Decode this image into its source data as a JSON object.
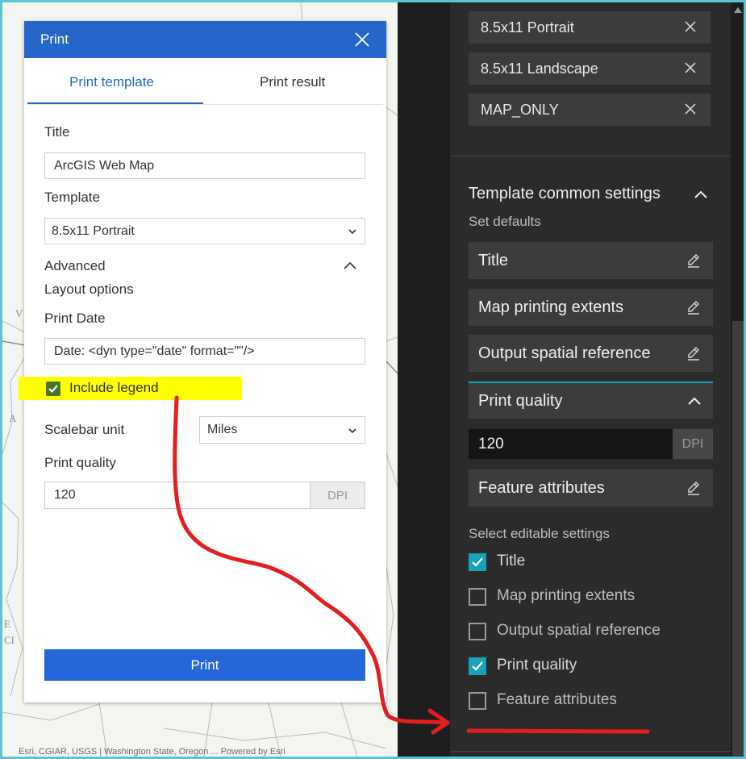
{
  "dialog": {
    "title": "Print",
    "tabs": [
      "Print template",
      "Print result"
    ],
    "title_label": "Title",
    "title_value": "ArcGIS Web Map",
    "template_label": "Template",
    "template_value": "8.5x11 Portrait",
    "advanced_label": "Advanced",
    "layout_options_label": "Layout options",
    "print_date_label": "Print Date",
    "print_date_value": "Date: <dyn type=\"date\" format=\"\"/>",
    "include_legend_label": "Include legend",
    "include_legend_checked": true,
    "scalebar_label": "Scalebar unit",
    "scalebar_value": "Miles",
    "print_quality_label": "Print quality",
    "print_quality_value": "120",
    "dpi_suffix": "DPI",
    "print_button": "Print"
  },
  "settings": {
    "template_chips": [
      "8.5x11 Portrait",
      "8.5x11 Landscape",
      "MAP_ONLY"
    ],
    "section_title": "Template common settings",
    "set_defaults": "Set defaults",
    "rows": {
      "title": "Title",
      "map_extents": "Map printing extents",
      "spatial_ref": "Output spatial reference",
      "print_quality": "Print quality",
      "feature_attributes": "Feature attributes"
    },
    "dpi_value": "120",
    "dpi_suffix": "DPI",
    "editable_heading": "Select editable settings",
    "editable": [
      {
        "label": "Title",
        "checked": true
      },
      {
        "label": "Map printing extents",
        "checked": false
      },
      {
        "label": "Output spatial reference",
        "checked": false
      },
      {
        "label": "Print quality",
        "checked": true
      },
      {
        "label": "Feature attributes",
        "checked": false
      }
    ]
  },
  "map": {
    "attribution": "Esri, CGIAR, USGS | Washington State, Oregon ... Powered by Esri"
  },
  "colors": {
    "accent_blue": "#2566c8",
    "teal_check": "#19a3b8",
    "highlight_yellow": "#ffff00",
    "annotation_red": "#e31e1e",
    "legend_check_green": "#47752c"
  }
}
